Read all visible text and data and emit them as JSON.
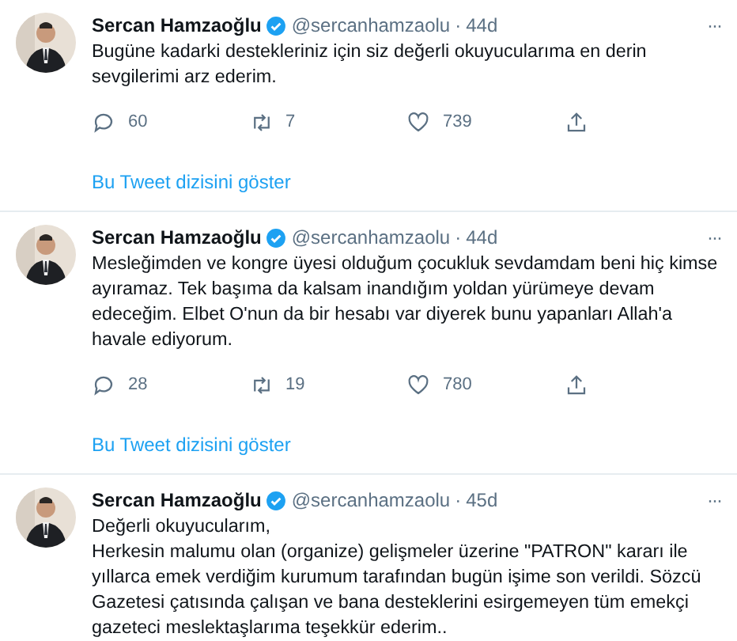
{
  "tweets": [
    {
      "name": "Sercan Hamzaoğlu",
      "verified": true,
      "handle": "@sercanhamzaolu",
      "separator": "·",
      "time": "44d",
      "more": "···",
      "paragraphs": [
        "Bugüne kadarki destekleriniz için siz değerli okuyucularıma en derin sevgilerimi arz ederim."
      ],
      "replies": "60",
      "retweets": "7",
      "likes": "739",
      "thread_link": "Bu Tweet dizisini göster"
    },
    {
      "name": "Sercan Hamzaoğlu",
      "verified": true,
      "handle": "@sercanhamzaolu",
      "separator": "·",
      "time": "44d",
      "more": "···",
      "paragraphs": [
        "Mesleğimden ve kongre üyesi olduğum çocukluk sevdamdam beni hiç kimse ayıramaz. Tek başıma da kalsam inandığım yoldan yürümeye devam edeceğim. Elbet O'nun da bir hesabı var diyerek bunu yapanları Allah'a havale ediyorum."
      ],
      "replies": "28",
      "retweets": "19",
      "likes": "780",
      "thread_link": "Bu Tweet dizisini göster"
    },
    {
      "name": "Sercan Hamzaoğlu",
      "verified": true,
      "handle": "@sercanhamzaolu",
      "separator": "·",
      "time": "45d",
      "more": "···",
      "paragraphs": [
        "Değerli okuyucularım,",
        "Herkesin malumu olan (organize) gelişmeler üzerine \"PATRON\" kararı ile yıllarca emek verdiğim kurumum tarafından bugün işime son verildi. Sözcü Gazetesi çatısında çalışan ve bana desteklerini esirgemeyen tüm emekçi gazeteci meslektaşlarıma teşekkür ederim.."
      ]
    }
  ]
}
